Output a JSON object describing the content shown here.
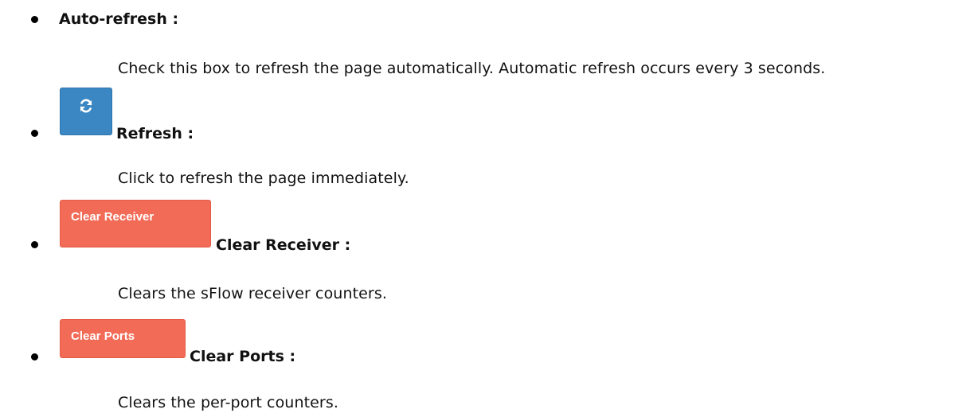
{
  "items": [
    {
      "term": "Auto-refresh :",
      "description": "Check this box to refresh the page automatically. Automatic refresh occurs every 3 seconds."
    },
    {
      "term": "Refresh :",
      "description": "Click to refresh the page immediately.",
      "icon": "refresh-icon"
    },
    {
      "term": "Clear Receiver :",
      "description": "Clears the sFlow receiver counters.",
      "button_label": "Clear Receiver"
    },
    {
      "term": "Clear Ports :",
      "description": "Clears the per-port counters.",
      "button_label": "Clear Ports"
    }
  ],
  "colors": {
    "refresh_button": "#3a87c4",
    "clear_button": "#f26b57"
  }
}
